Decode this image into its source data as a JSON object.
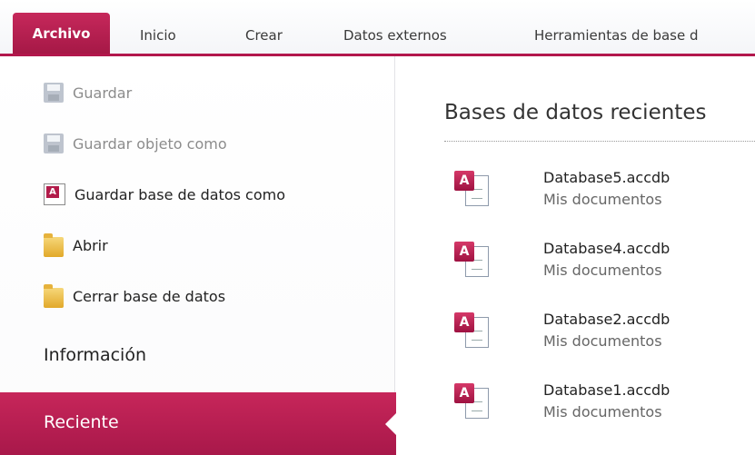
{
  "ribbon": {
    "tabs": [
      "Archivo",
      "Inicio",
      "Crear",
      "Datos externos",
      "Herramientas de base d"
    ]
  },
  "menu": {
    "commands": [
      {
        "label": "Guardar",
        "icon": "save-icon",
        "enabled": false
      },
      {
        "label": "Guardar objeto como",
        "icon": "save-object-icon",
        "enabled": false
      },
      {
        "label": "Guardar base de datos como",
        "icon": "save-database-as-icon",
        "enabled": true
      },
      {
        "label": "Abrir",
        "icon": "open-folder-icon",
        "enabled": true
      },
      {
        "label": "Cerrar base de datos",
        "icon": "close-database-icon",
        "enabled": true
      }
    ],
    "informacion": "Información",
    "reciente": "Reciente"
  },
  "recent": {
    "title": "Bases de datos recientes",
    "files": [
      {
        "name": "Database5.accdb",
        "location": "Mis documentos"
      },
      {
        "name": "Database4.accdb",
        "location": "Mis documentos"
      },
      {
        "name": "Database2.accdb",
        "location": "Mis documentos"
      },
      {
        "name": "Database1.accdb",
        "location": "Mis documentos"
      }
    ]
  },
  "colors": {
    "accent": "#b2174c",
    "text": "#222222",
    "disabled": "#8c8c8c"
  }
}
